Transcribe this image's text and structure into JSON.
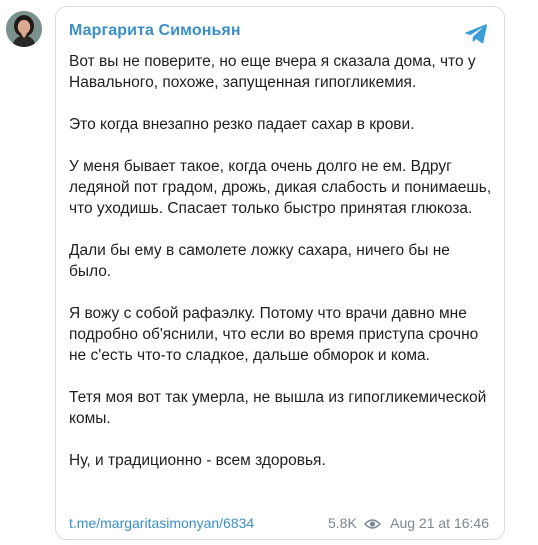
{
  "channel": {
    "name": "Маргарита Симоньян",
    "avatar_icon": "profile-photo",
    "platform_icon": "telegram-icon",
    "accent_color": "#3a8fc7"
  },
  "message": {
    "paragraphs": [
      "Вот вы не поверите, но еще вчера я сказала дома, что у Навального, похоже, запущенная гипогликемия.",
      "Это когда внезапно резко падает сахар в крови.",
      "У меня бывает такое, когда очень долго не ем. Вдруг ледяной пот градом, дрожь, дикая слабость и понимаешь, что уходишь. Спасает только быстро принятая глюкоза.",
      "Дали бы ему в самолете ложку сахара, ничего бы не было.",
      "Я вожу с собой рафаэлку. Потому что врачи давно мне подробно об'яснили, что если во время приступа срочно не с'есть что-то сладкое, дальше обморок и кома.",
      "Тетя моя вот так умерла, не вышла из гипогликемической комы.",
      "Ну, и традиционно - всем здоровья."
    ]
  },
  "footer": {
    "link": "t.me/margaritasimonyan/6834",
    "views": "5.8K",
    "views_icon": "eye-icon",
    "timestamp": "Aug 21 at 16:46"
  }
}
